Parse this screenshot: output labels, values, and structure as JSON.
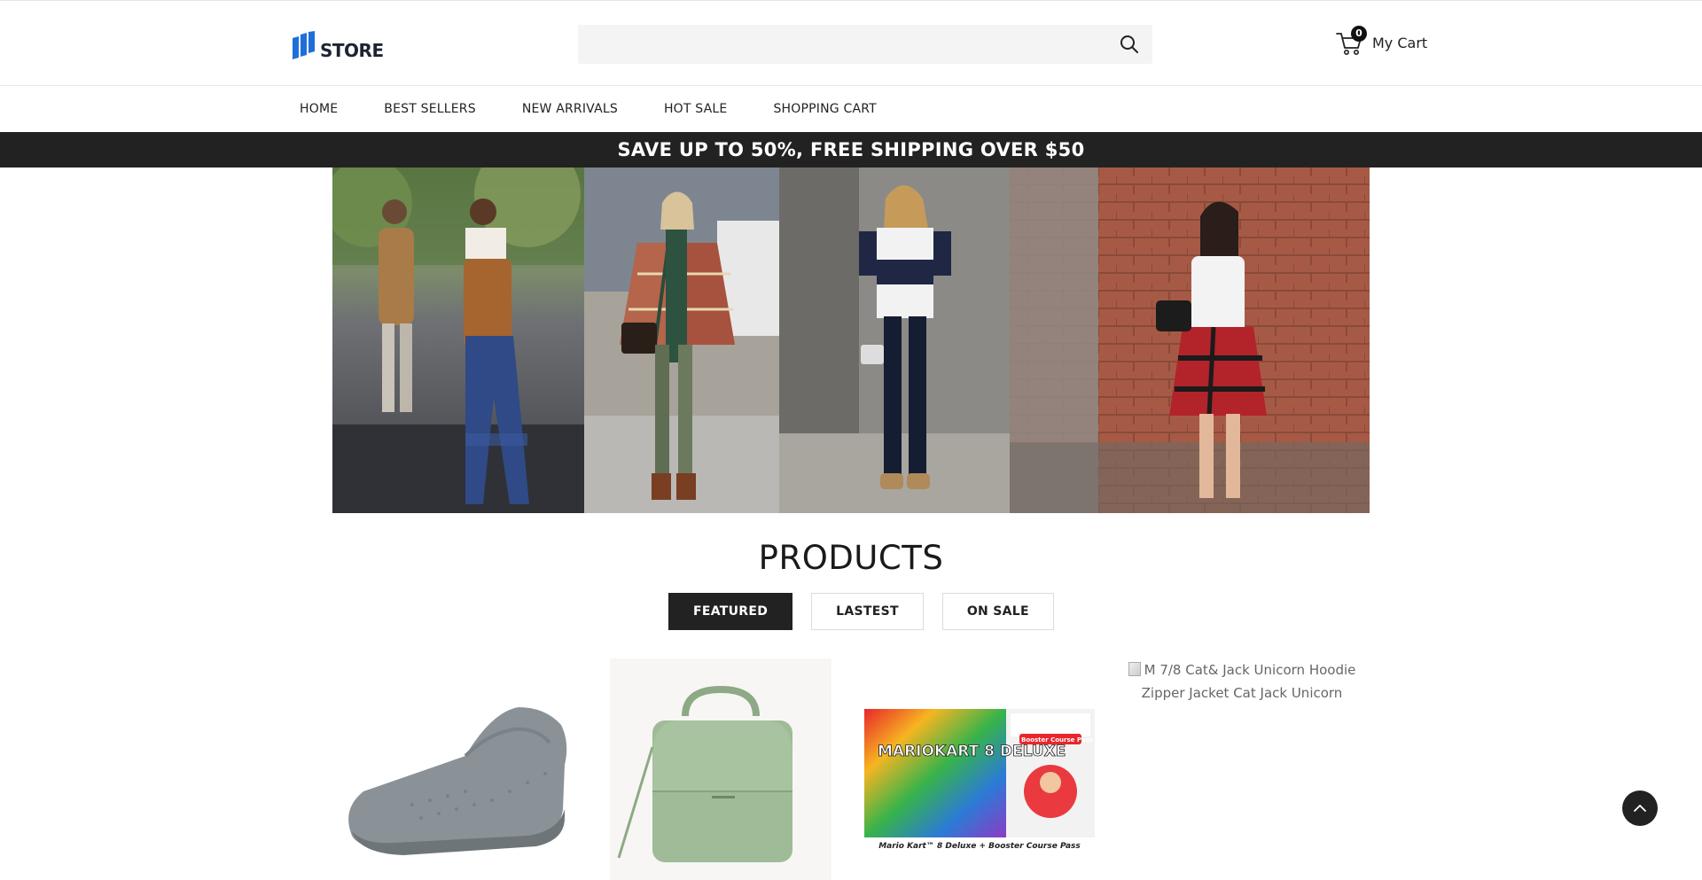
{
  "header": {
    "logo_text": "STORE",
    "search_placeholder": "",
    "cart": {
      "count": "0",
      "label": "My Cart"
    }
  },
  "nav": {
    "items": [
      "HOME",
      "BEST SELLERS",
      "NEW ARRIVALS",
      "HOT SALE",
      "SHOPPING CART"
    ]
  },
  "promo": {
    "text": "SAVE UP TO 50%, FREE SHIPPING OVER $50"
  },
  "products": {
    "title": "PRODUCTS",
    "tabs": [
      "FEATURED",
      "LASTEST",
      "ON SALE"
    ],
    "active_tab": "FEATURED",
    "items": [
      {
        "image": "grey-slip-on-sneaker"
      },
      {
        "image": "sage-green-handbag"
      },
      {
        "image": "mario-kart-8-deluxe-booster-course-pass",
        "image_text_title": "MARIOKART 8 DELUXE",
        "image_text_caption": "Mario Kart™ 8 Deluxe + Booster Course Pass",
        "image_text_badge": "Booster Course Pass"
      },
      {
        "alt_text": "M 7/8 Cat& Jack Unicorn Hoodie Zipper Jacket Cat Jack Unicorn"
      }
    ]
  },
  "colors": {
    "accent_dark": "#222222",
    "logo_blue": "#1e6fd9"
  }
}
